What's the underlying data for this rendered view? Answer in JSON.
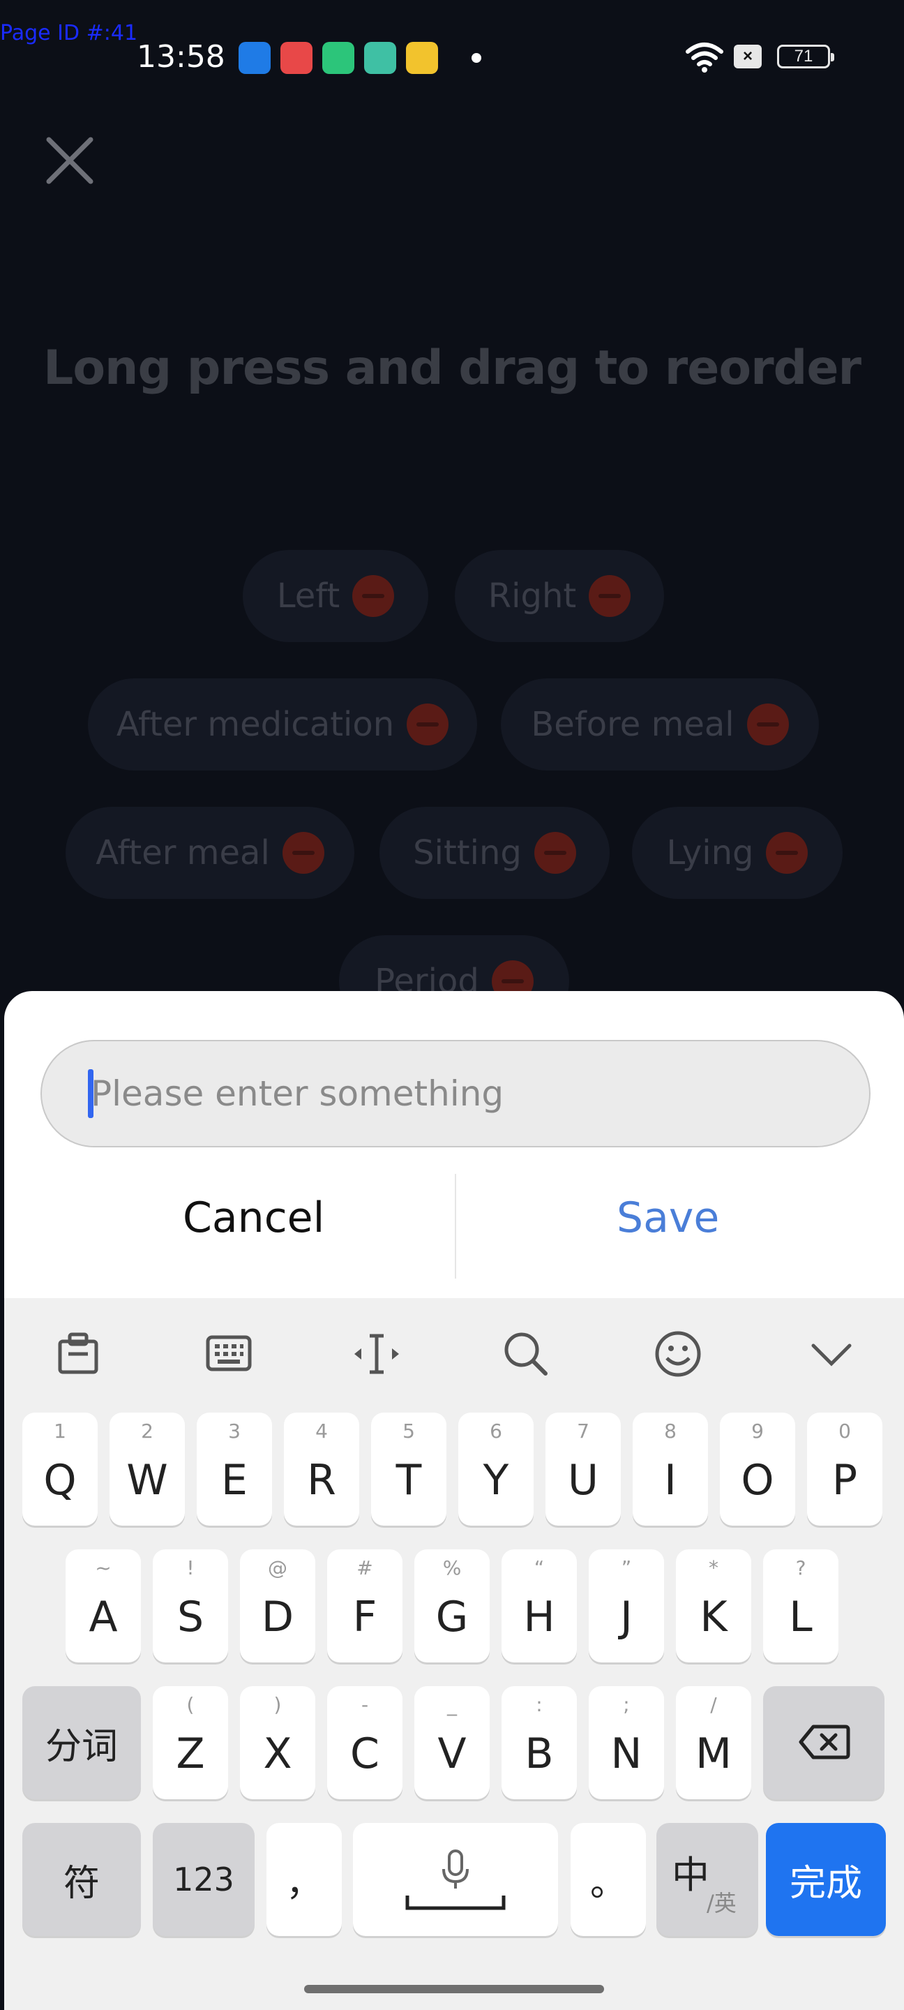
{
  "page_id": "Page ID #:41",
  "status_bar": {
    "time": "13:58",
    "battery": "71",
    "sim_indicator": "×",
    "app_icon_colors": [
      "#1f7be6",
      "#e84848",
      "#2cc57a",
      "#3fc0a4",
      "#f2c32d"
    ]
  },
  "title": "Long press and drag to reorder",
  "tags": [
    "Left",
    "Right",
    "After medication",
    "Before meal",
    "After meal",
    "Sitting",
    "Lying",
    "Period"
  ],
  "dialog": {
    "input_placeholder": "Please enter something",
    "cancel_label": "Cancel",
    "save_label": "Save"
  },
  "keyboard": {
    "row1": [
      {
        "main": "Q",
        "sub": "1"
      },
      {
        "main": "W",
        "sub": "2"
      },
      {
        "main": "E",
        "sub": "3"
      },
      {
        "main": "R",
        "sub": "4"
      },
      {
        "main": "T",
        "sub": "5"
      },
      {
        "main": "Y",
        "sub": "6"
      },
      {
        "main": "U",
        "sub": "7"
      },
      {
        "main": "I",
        "sub": "8"
      },
      {
        "main": "O",
        "sub": "9"
      },
      {
        "main": "P",
        "sub": "0"
      }
    ],
    "row2": [
      {
        "main": "A",
        "sub": "~"
      },
      {
        "main": "S",
        "sub": "!"
      },
      {
        "main": "D",
        "sub": "@"
      },
      {
        "main": "F",
        "sub": "#"
      },
      {
        "main": "G",
        "sub": "%"
      },
      {
        "main": "H",
        "sub": "“"
      },
      {
        "main": "J",
        "sub": "”"
      },
      {
        "main": "K",
        "sub": "*"
      },
      {
        "main": "L",
        "sub": "?"
      }
    ],
    "row3": [
      {
        "main": "Z",
        "sub": "("
      },
      {
        "main": "X",
        "sub": ")"
      },
      {
        "main": "C",
        "sub": "-"
      },
      {
        "main": "V",
        "sub": "_"
      },
      {
        "main": "B",
        "sub": ":"
      },
      {
        "main": "N",
        "sub": ";"
      },
      {
        "main": "M",
        "sub": "/"
      }
    ],
    "fenci_label": "分词",
    "symbol_label": "符",
    "num_label": "123",
    "comma_label": "，",
    "period_label": "。",
    "lang_label": "中",
    "lang_sub": "/英",
    "done_label": "完成",
    "accent_color": "#1f74f0"
  }
}
